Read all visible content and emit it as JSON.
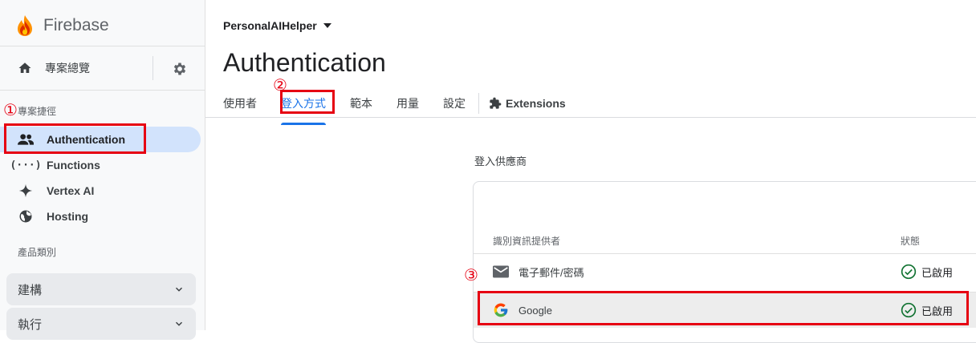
{
  "sidebar": {
    "brand": "Firebase",
    "overview_label": "專案總覽",
    "shortcuts_label": "專案捷徑",
    "nav_items": [
      {
        "label": "Authentication",
        "icon": "people-icon"
      },
      {
        "label": "Functions",
        "icon": "functions-icon"
      },
      {
        "label": "Vertex AI",
        "icon": "sparkle-icon"
      },
      {
        "label": "Hosting",
        "icon": "globe-icon"
      }
    ],
    "categories_label": "產品類別",
    "categories": [
      "建構",
      "執行"
    ]
  },
  "header": {
    "project_name": "PersonalAIHelper",
    "page_title": "Authentication"
  },
  "tabs": [
    "使用者",
    "登入方式",
    "範本",
    "用量",
    "設定"
  ],
  "active_tab": "登入方式",
  "extensions_label": "Extensions",
  "providers": {
    "section_label": "登入供應商",
    "col_provider": "識別資訊提供者",
    "col_status": "狀態",
    "rows": [
      {
        "name": "電子郵件/密碼",
        "status": "已啟用",
        "icon": "mail-icon"
      },
      {
        "name": "Google",
        "status": "已啟用",
        "icon": "google-icon"
      }
    ]
  },
  "annotations": [
    "①",
    "②",
    "③"
  ],
  "colors": {
    "accent": "#1a73e8",
    "annotation_red": "#e60012",
    "active_nav_bg": "#d2e3fc"
  }
}
